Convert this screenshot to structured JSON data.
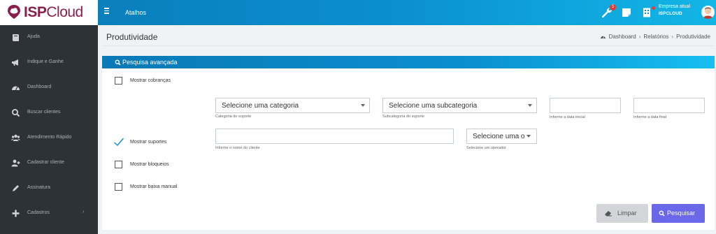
{
  "brand": {
    "name_part1": "ISP",
    "name_part2": "Cloud"
  },
  "topbar": {
    "shortcuts_label": "Atalhos",
    "notification_count": "5",
    "company_label": "Empresa atual",
    "company_name": "ISPCLOUD"
  },
  "sidebar": {
    "items": [
      {
        "label": "Ajuda",
        "icon": "book-icon"
      },
      {
        "label": "Indique e Ganhe",
        "icon": "megaphone-icon"
      },
      {
        "label": "Dashboard",
        "icon": "gauge-icon"
      },
      {
        "label": "Buscar clientes",
        "icon": "search-icon"
      },
      {
        "label": "Atendimento Rápido",
        "icon": "users-icon"
      },
      {
        "label": "Cadastrar cliente",
        "icon": "user-plus-icon"
      },
      {
        "label": "Assinatura",
        "icon": "pen-icon"
      },
      {
        "label": "Cadastros",
        "icon": "plus-icon"
      }
    ],
    "chevron": "›"
  },
  "page": {
    "title": "Produtividade",
    "breadcrumb": {
      "dashboard": "Dashboard",
      "reports": "Relatórios",
      "current": "Produtividade"
    }
  },
  "advanced_search": {
    "title": "Pesquisa avançada",
    "show_charges": {
      "label": "Mostrar cobranças",
      "checked": false
    },
    "category_select": {
      "value": "Selecione uma categoria",
      "help": "Categoria do suporte"
    },
    "subcategory_select": {
      "value": "Selecione uma subcategoria",
      "help": "Subcategoria do suporte"
    },
    "start_date": {
      "value": "",
      "help": "Informe a data inicial"
    },
    "end_date": {
      "value": "",
      "help": "Informe a data final"
    },
    "show_supports": {
      "label": "Mostrar suportes",
      "checked": true
    },
    "client_name": {
      "value": "",
      "help": "Informe o nome do cliente"
    },
    "operator_select": {
      "value": "Selecione uma operador",
      "help": "Selecione um operador"
    },
    "show_blocks": {
      "label": "Mostrar bloqueios",
      "checked": false
    },
    "show_manual": {
      "label": "Mostrar baixa manual",
      "checked": false
    },
    "clear_button": "Limpar",
    "search_button": "Pesquisar"
  },
  "colors": {
    "topbar": "#0b8fcf",
    "sidebar": "#2d3237",
    "search_button": "#6a67e8",
    "brand": "#8a1f4e"
  }
}
